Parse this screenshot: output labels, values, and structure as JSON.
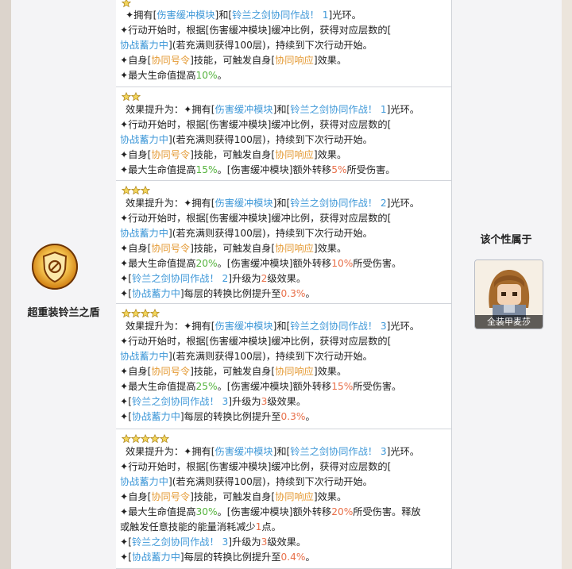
{
  "skill": {
    "name": "超重装铃兰之盾",
    "icon": "shield-emblem-icon"
  },
  "belongs": {
    "title": "该个性属于",
    "character_name": "全装甲麦莎"
  },
  "colors": {
    "keyword_blue": "#3f98d8",
    "keyword_orange": "#e49a34",
    "value_green": "#55b33d",
    "value_red": "#e8704a"
  },
  "levels": [
    {
      "stars": 1,
      "lines": [
        [
          {
            "t": "✦拥有["
          },
          {
            "t": "伤害缓冲模块",
            "c": "b"
          },
          {
            "t": "]和["
          },
          {
            "t": "铃兰之剑协同作战！ 1",
            "c": "b"
          },
          {
            "t": "]光环。"
          }
        ],
        [
          {
            "t": "✦行动开始时，根据[伤害缓冲模块]缓冲比例，获得对应层数的["
          }
        ],
        [
          {
            "t": "协战蓄力中",
            "c": "b"
          },
          {
            "t": "](若充满则获得100层)，持续到下次行动开始。"
          }
        ],
        [
          {
            "t": "✦自身["
          },
          {
            "t": "协同号令",
            "c": "o"
          },
          {
            "t": "]技能，可触发自身["
          },
          {
            "t": "协同响应",
            "c": "o"
          },
          {
            "t": "]效果。"
          }
        ],
        [
          {
            "t": "✦最大生命值提高"
          },
          {
            "t": "10%",
            "c": "g"
          },
          {
            "t": "。"
          }
        ]
      ]
    },
    {
      "stars": 2,
      "lines": [
        [
          {
            "t": "效果提升为：✦拥有["
          },
          {
            "t": "伤害缓冲模块",
            "c": "b"
          },
          {
            "t": "]和["
          },
          {
            "t": "铃兰之剑协同作战！ 1",
            "c": "b"
          },
          {
            "t": "]光环。"
          }
        ],
        [
          {
            "t": "✦行动开始时，根据[伤害缓冲模块]缓冲比例，获得对应层数的["
          }
        ],
        [
          {
            "t": "协战蓄力中",
            "c": "b"
          },
          {
            "t": "](若充满则获得100层)，持续到下次行动开始。"
          }
        ],
        [
          {
            "t": "✦自身["
          },
          {
            "t": "协同号令",
            "c": "o"
          },
          {
            "t": "]技能，可触发自身["
          },
          {
            "t": "协同响应",
            "c": "o"
          },
          {
            "t": "]效果。"
          }
        ],
        [
          {
            "t": "✦最大生命值提高"
          },
          {
            "t": "15%",
            "c": "g"
          },
          {
            "t": "。[伤害缓冲模块]额外转移"
          },
          {
            "t": "5%",
            "c": "r"
          },
          {
            "t": "所受伤害。"
          }
        ]
      ]
    },
    {
      "stars": 3,
      "lines": [
        [
          {
            "t": "效果提升为：✦拥有["
          },
          {
            "t": "伤害缓冲模块",
            "c": "b"
          },
          {
            "t": "]和["
          },
          {
            "t": "铃兰之剑协同作战！ 2",
            "c": "b"
          },
          {
            "t": "]光环。"
          }
        ],
        [
          {
            "t": "✦行动开始时，根据[伤害缓冲模块]缓冲比例，获得对应层数的["
          }
        ],
        [
          {
            "t": "协战蓄力中",
            "c": "b"
          },
          {
            "t": "](若充满则获得100层)，持续到下次行动开始。"
          }
        ],
        [
          {
            "t": "✦自身["
          },
          {
            "t": "协同号令",
            "c": "o"
          },
          {
            "t": "]技能，可触发自身["
          },
          {
            "t": "协同响应",
            "c": "o"
          },
          {
            "t": "]效果。"
          }
        ],
        [
          {
            "t": "✦最大生命值提高"
          },
          {
            "t": "20%",
            "c": "g"
          },
          {
            "t": "。[伤害缓冲模块]额外转移"
          },
          {
            "t": "10%",
            "c": "r"
          },
          {
            "t": "所受伤害。"
          }
        ],
        [
          {
            "t": "✦["
          },
          {
            "t": "铃兰之剑协同作战！ 2",
            "c": "b"
          },
          {
            "t": "]升级为"
          },
          {
            "t": "2",
            "c": "r"
          },
          {
            "t": "级效果。"
          }
        ],
        [
          {
            "t": "✦["
          },
          {
            "t": "协战蓄力中",
            "c": "b"
          },
          {
            "t": "]每层的转换比例提升至"
          },
          {
            "t": "0.3%",
            "c": "r"
          },
          {
            "t": "。"
          }
        ]
      ]
    },
    {
      "stars": 4,
      "lines": [
        [
          {
            "t": "效果提升为：✦拥有["
          },
          {
            "t": "伤害缓冲模块",
            "c": "b"
          },
          {
            "t": "]和["
          },
          {
            "t": "铃兰之剑协同作战！ 3",
            "c": "b"
          },
          {
            "t": "]光环。"
          }
        ],
        [
          {
            "t": "✦行动开始时，根据[伤害缓冲模块]缓冲比例，获得对应层数的["
          }
        ],
        [
          {
            "t": "协战蓄力中",
            "c": "b"
          },
          {
            "t": "](若充满则获得100层)，持续到下次行动开始。"
          }
        ],
        [
          {
            "t": "✦自身["
          },
          {
            "t": "协同号令",
            "c": "o"
          },
          {
            "t": "]技能，可触发自身["
          },
          {
            "t": "协同响应",
            "c": "o"
          },
          {
            "t": "]效果。"
          }
        ],
        [
          {
            "t": "✦最大生命值提高"
          },
          {
            "t": "25%",
            "c": "g"
          },
          {
            "t": "。[伤害缓冲模块]额外转移"
          },
          {
            "t": "15%",
            "c": "r"
          },
          {
            "t": "所受伤害。"
          }
        ],
        [
          {
            "t": "✦["
          },
          {
            "t": "铃兰之剑协同作战！ 3",
            "c": "b"
          },
          {
            "t": "]升级为"
          },
          {
            "t": "3",
            "c": "r"
          },
          {
            "t": "级效果。"
          }
        ],
        [
          {
            "t": "✦["
          },
          {
            "t": "协战蓄力中",
            "c": "b"
          },
          {
            "t": "]每层的转换比例提升至"
          },
          {
            "t": "0.3%",
            "c": "r"
          },
          {
            "t": "。"
          }
        ]
      ]
    },
    {
      "stars": 5,
      "lines": [
        [
          {
            "t": "效果提升为：✦拥有["
          },
          {
            "t": "伤害缓冲模块",
            "c": "b"
          },
          {
            "t": "]和["
          },
          {
            "t": "铃兰之剑协同作战！ 3",
            "c": "b"
          },
          {
            "t": "]光环。"
          }
        ],
        [
          {
            "t": "✦行动开始时，根据[伤害缓冲模块]缓冲比例，获得对应层数的["
          }
        ],
        [
          {
            "t": "协战蓄力中",
            "c": "b"
          },
          {
            "t": "](若充满则获得100层)，持续到下次行动开始。"
          }
        ],
        [
          {
            "t": "✦自身["
          },
          {
            "t": "协同号令",
            "c": "o"
          },
          {
            "t": "]技能，可触发自身["
          },
          {
            "t": "协同响应",
            "c": "o"
          },
          {
            "t": "]效果。"
          }
        ],
        [
          {
            "t": "✦最大生命值提高"
          },
          {
            "t": "30%",
            "c": "g"
          },
          {
            "t": "。[伤害缓冲模块]额外转移"
          },
          {
            "t": "20%",
            "c": "r"
          },
          {
            "t": "所受伤害。释放"
          }
        ],
        [
          {
            "t": "或触发任意技能的能量消耗减少"
          },
          {
            "t": "1",
            "c": "r"
          },
          {
            "t": "点。"
          }
        ],
        [
          {
            "t": "✦["
          },
          {
            "t": "铃兰之剑协同作战！ 3",
            "c": "b"
          },
          {
            "t": "]升级为"
          },
          {
            "t": "3",
            "c": "r"
          },
          {
            "t": "级效果。"
          }
        ],
        [
          {
            "t": "✦["
          },
          {
            "t": "协战蓄力中",
            "c": "b"
          },
          {
            "t": "]每层的转换比例提升至"
          },
          {
            "t": "0.4%",
            "c": "r"
          },
          {
            "t": "。"
          }
        ]
      ]
    }
  ]
}
